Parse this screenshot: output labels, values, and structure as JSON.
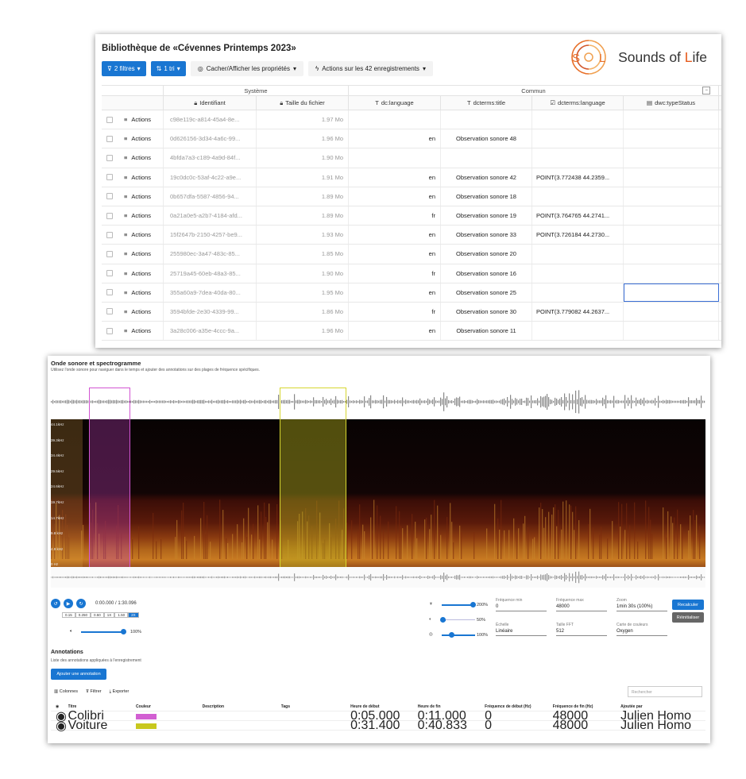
{
  "library": {
    "title": "Bibliothèque de «Cévennes Printemps 2023»",
    "toolbar": {
      "filters": "2 filtres",
      "sort": "1 tri",
      "props": "Cacher/Afficher les propriétés",
      "actions": "Actions sur les 42 enregistrements"
    },
    "logo": {
      "mark": "S L",
      "text_a": "Sounds of ",
      "text_b": "L",
      "text_c": "ife"
    },
    "groups": {
      "system": "Système",
      "common": "Commun",
      "collapse": "−"
    },
    "columns": [
      "Identifiant",
      "Taille du fichier",
      "dc:language",
      "dcterms:title",
      "dcterms:language",
      "dwc:typeStatus"
    ],
    "action_label": "Actions",
    "rows": [
      {
        "id": "c98e119c-a814-45a4-8e...",
        "size": "1.97 Mo",
        "lang": "",
        "title": "",
        "dlang": ""
      },
      {
        "id": "0d626156-3d34-4a6c-99...",
        "size": "1.96 Mo",
        "lang": "en",
        "title": "Observation sonore 48",
        "dlang": ""
      },
      {
        "id": "4bfda7a3-c189-4a9d-84f...",
        "size": "1.90 Mo",
        "lang": "",
        "title": "",
        "dlang": ""
      },
      {
        "id": "19c0dc0c-53af-4c22-a9e...",
        "size": "1.91 Mo",
        "lang": "en",
        "title": "Observation sonore 42",
        "dlang": "POINT(3.772438 44.2359..."
      },
      {
        "id": "0b657dfa-5587-4856-94...",
        "size": "1.89 Mo",
        "lang": "en",
        "title": "Observation sonore 18",
        "dlang": ""
      },
      {
        "id": "0a21a0e5-a2b7-4184-afd...",
        "size": "1.89 Mo",
        "lang": "fr",
        "title": "Observation sonore 19",
        "dlang": "POINT(3.764765 44.2741..."
      },
      {
        "id": "15f2647b-2150-4257-be9...",
        "size": "1.93 Mo",
        "lang": "en",
        "title": "Observation sonore 33",
        "dlang": "POINT(3.726184 44.2730..."
      },
      {
        "id": "255980ec-3a47-483c-85...",
        "size": "1.85 Mo",
        "lang": "en",
        "title": "Observation sonore 20",
        "dlang": ""
      },
      {
        "id": "25719a45-60eb-48a3-85...",
        "size": "1.90 Mo",
        "lang": "fr",
        "title": "Observation sonore 16",
        "dlang": ""
      },
      {
        "id": "355a60a9-7dea-40da-80...",
        "size": "1.95 Mo",
        "lang": "en",
        "title": "Observation sonore 25",
        "dlang": ""
      },
      {
        "id": "3594bfde-2e30-4339-99...",
        "size": "1.86 Mo",
        "lang": "fr",
        "title": "Observation sonore 30",
        "dlang": "POINT(3.779082 44.2637..."
      },
      {
        "id": "3a28c006-a35e-4ccc-9a...",
        "size": "1.96 Mo",
        "lang": "en",
        "title": "Observation sonore 11",
        "dlang": ""
      }
    ]
  },
  "audio": {
    "title": "Onde sonore et spectrogramme",
    "subtitle": "Utilisez l'onde sonore pour naviguer dans le temps et ajouter des annotations sur des plages de fréquence spécifiques.",
    "freq_labels": [
      "44.1kHz",
      "39.3kHz",
      "34.4kHz",
      "29.5kHz",
      "24.6kHz",
      "19.7kHz",
      "14.7kHz",
      "9.8 kHz",
      "4.9 kHz",
      "0 Hz"
    ],
    "time": "0:00.000 / 1:30.096",
    "speeds": [
      "0.15",
      "0.250",
      "0.50",
      "1X",
      "1.50",
      "2X"
    ],
    "volume": "100%",
    "sliders": [
      "200%",
      "50%",
      "100%"
    ],
    "fields": {
      "fmin_label": "Fréquence min",
      "fmin": "0",
      "fmax_label": "Fréquence max",
      "fmax": "48000",
      "zoom_label": "Zoom",
      "zoom": "1min 30s (100%)",
      "scale_label": "Échelle",
      "scale": "Linéaire",
      "fft_label": "Taille FFT",
      "fft": "512",
      "cmap_label": "Carte de couleurs",
      "cmap": "Oxygen"
    },
    "recalc": "Recalculer",
    "reset": "Réinitialiser"
  },
  "annotations": {
    "title": "Annotations",
    "subtitle": "Liste des annotations appliquées à l'enregistrement",
    "add": "Ajouter une annotation",
    "tools": {
      "columns": "Colonnes",
      "filter": "Filtrer",
      "export": "Exporter",
      "search": "Rechercher"
    },
    "headers": [
      "Titre",
      "Couleur",
      "Description",
      "Tags",
      "Heure de début",
      "Heure de fin",
      "Fréquence de début (Hz)",
      "Fréquence de fin (Hz)",
      "Ajoutée par"
    ],
    "rows": [
      {
        "title": "Colibri",
        "color": "#d25fd2",
        "start": "0:05.000",
        "end": "0:11.000",
        "fs": "0",
        "fe": "48000",
        "by": "Julien Homo"
      },
      {
        "title": "Voiture",
        "color": "#c8c81e",
        "start": "0:31.400",
        "end": "0:40.833",
        "fs": "0",
        "fe": "48000",
        "by": "Julien Homo"
      }
    ]
  }
}
